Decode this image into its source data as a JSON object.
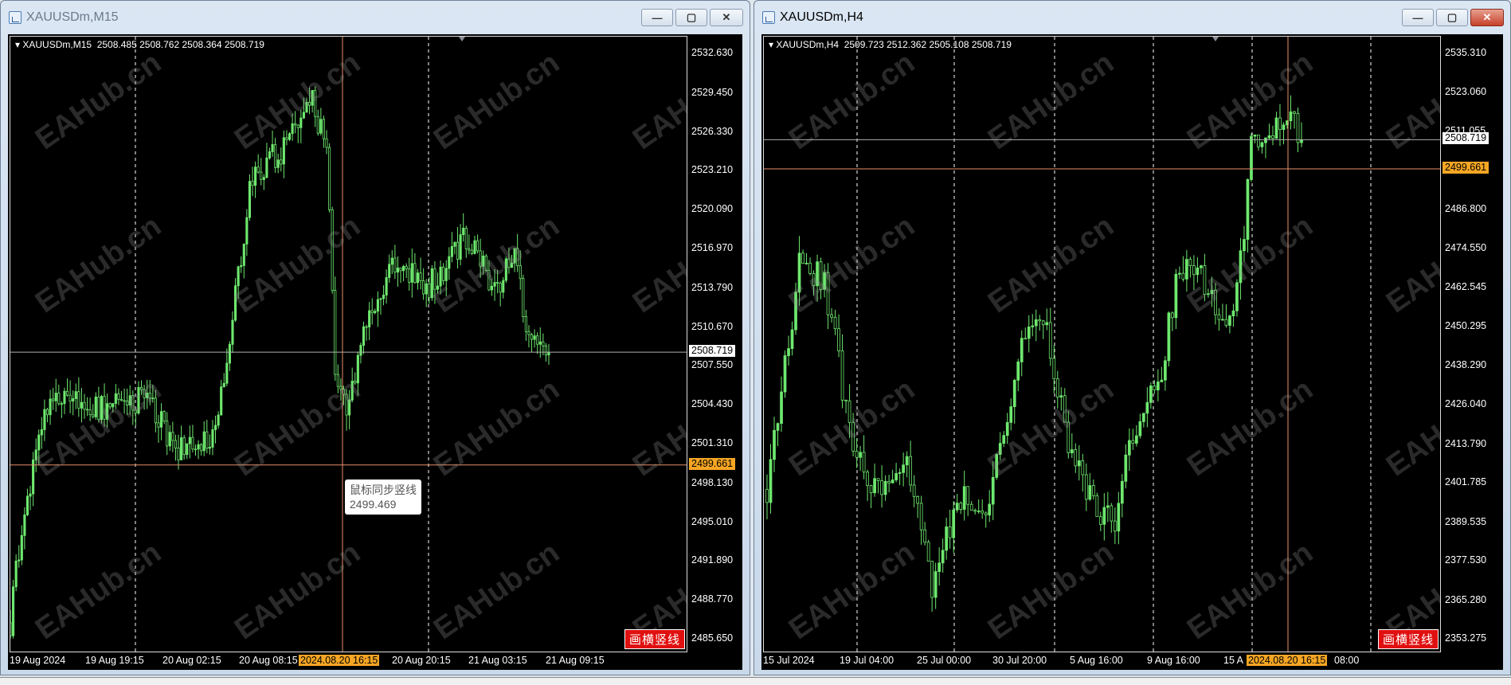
{
  "watermark": "EAHub.cn",
  "colors": {
    "bull": "#6ee86e",
    "bear_fill": "#000000",
    "grid": "#ffffff",
    "crosshair": "#e8906a",
    "price_line": "#b0b0b0",
    "level_line": "#e8906a",
    "level_label": "#f5a623",
    "button": "#e01010"
  },
  "windows": [
    {
      "title": "XAUUSDm,M15",
      "info": "XAUUSDm,M15  2508.485 2508.762 2508.364 2508.719",
      "button_label": "画横竖线",
      "current_price": "2508.719",
      "level_price": "2499.661",
      "tooltip": {
        "label": "鼠标同步竖线",
        "value": "2499.469"
      },
      "crosshair_time": "2024.08.20 16:15",
      "price_labels": [
        "2532.630",
        "2529.450",
        "2526.330",
        "2523.210",
        "2520.090",
        "2516.970",
        "2513.790",
        "2510.670",
        "2507.550",
        "2504.430",
        "2501.310",
        "2498.130",
        "2495.010",
        "2491.890",
        "2488.770",
        "2485.650"
      ],
      "time_labels": [
        "19 Aug 2024",
        "19 Aug 19:15",
        "20 Aug 02:15",
        "20 Aug 08:15",
        "20 Aug 20:15",
        "21 Aug 03:15",
        "21 Aug 09:15"
      ],
      "chart_data": {
        "type": "candlestick",
        "ylim": [
          2485.65,
          2532.63
        ],
        "count": 190,
        "volatility": 1.4,
        "anchors": [
          [
            0,
            2487
          ],
          [
            4,
            2495
          ],
          [
            14,
            2505
          ],
          [
            31,
            2504
          ],
          [
            48,
            2505
          ],
          [
            58,
            2501
          ],
          [
            72,
            2502
          ],
          [
            79,
            2513
          ],
          [
            85,
            2523
          ],
          [
            96,
            2525
          ],
          [
            106,
            2529
          ],
          [
            111,
            2525
          ],
          [
            114,
            2508
          ],
          [
            118,
            2504
          ],
          [
            126,
            2512
          ],
          [
            135,
            2516
          ],
          [
            147,
            2514
          ],
          [
            157,
            2517
          ],
          [
            160,
            2518
          ],
          [
            170,
            2514
          ],
          [
            177,
            2516
          ],
          [
            182,
            2510
          ],
          [
            189,
            2508.7
          ]
        ]
      }
    },
    {
      "title": "XAUUSDm,H4",
      "info": "XAUUSDm,H4  2509.723 2512.362 2505.108 2508.719",
      "button_label": "画横竖线",
      "current_price": "2508.719",
      "level_price": "2499.661",
      "crosshair_time": "2024.08.20 16:15",
      "price_labels": [
        "2535.310",
        "2523.060",
        "2511.055",
        "2486.800",
        "2474.550",
        "2462.545",
        "2450.295",
        "2438.290",
        "2426.040",
        "2413.790",
        "2401.785",
        "2389.535",
        "2377.530",
        "2365.280",
        "2353.275"
      ],
      "time_labels": [
        "15 Jul 2024",
        "19 Jul 04:00",
        "25 Jul 00:00",
        "30 Jul 20:00",
        "5 Aug 16:00",
        "9 Aug 16:00",
        "15 A",
        "08:00"
      ],
      "chart_data": {
        "type": "candlestick",
        "ylim": [
          2353.275,
          2535.31
        ],
        "count": 150,
        "volatility": 6,
        "anchors": [
          [
            0,
            2400
          ],
          [
            4,
            2430
          ],
          [
            9,
            2470
          ],
          [
            16,
            2465
          ],
          [
            20,
            2440
          ],
          [
            24,
            2410
          ],
          [
            31,
            2400
          ],
          [
            38,
            2410
          ],
          [
            42,
            2395
          ],
          [
            46,
            2370
          ],
          [
            50,
            2385
          ],
          [
            55,
            2400
          ],
          [
            61,
            2390
          ],
          [
            66,
            2420
          ],
          [
            72,
            2450
          ],
          [
            77,
            2455
          ],
          [
            81,
            2430
          ],
          [
            85,
            2410
          ],
          [
            91,
            2395
          ],
          [
            97,
            2390
          ],
          [
            100,
            2410
          ],
          [
            104,
            2425
          ],
          [
            109,
            2432
          ],
          [
            115,
            2470
          ],
          [
            122,
            2465
          ],
          [
            126,
            2452
          ],
          [
            131,
            2460
          ],
          [
            135,
            2505
          ],
          [
            139,
            2510
          ],
          [
            145,
            2518
          ],
          [
            149,
            2508.7
          ]
        ]
      }
    }
  ]
}
